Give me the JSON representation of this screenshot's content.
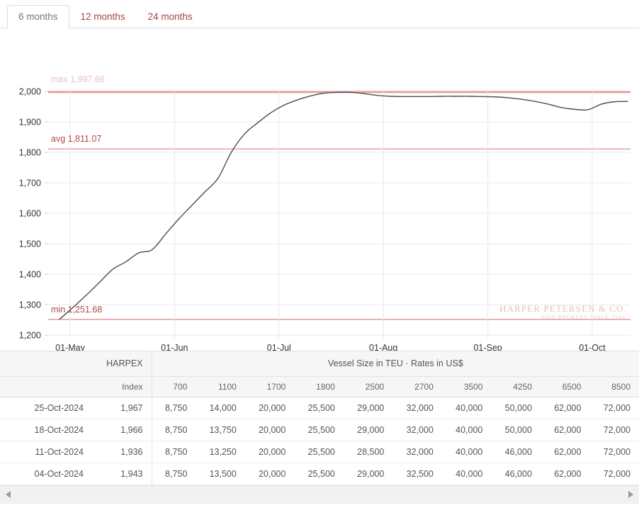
{
  "tabs": [
    {
      "label": "6 months",
      "active": true
    },
    {
      "label": "12 months",
      "active": false
    },
    {
      "label": "24 months",
      "active": false
    }
  ],
  "colors": {
    "accent": "#a94442",
    "reference_line": "#e8a0a0",
    "series_line": "#4d4d4d",
    "grid": "#e8e8e8",
    "watermark": "#e2bfc0"
  },
  "chart_data": {
    "type": "line",
    "title": "",
    "xlabel": "",
    "ylabel": "",
    "ylim": [
      1200,
      2000
    ],
    "grid": true,
    "legend": "none",
    "ytick_labels": [
      "2,000",
      "1,900",
      "1,800",
      "1,700",
      "1,600",
      "1,500",
      "1,400",
      "1,300",
      "1,200"
    ],
    "yticks": [
      2000,
      1900,
      1800,
      1700,
      1600,
      1500,
      1400,
      1300,
      1200
    ],
    "xtick_labels": [
      "01-May",
      "01-Jun",
      "01-Jul",
      "01-Aug",
      "01-Sep",
      "01-Oct"
    ],
    "reference_lines": [
      {
        "name": "max",
        "label": "max 1,997.66",
        "value": 1998,
        "clipped": true
      },
      {
        "name": "avg",
        "label": "avg 1,811.07",
        "value": 1811.07,
        "clipped": false
      },
      {
        "name": "min",
        "label": "min 1,251.68",
        "value": 1251.68,
        "clipped": false
      }
    ],
    "series": [
      {
        "name": "HARPEX",
        "values": [
          1252,
          1290,
          1330,
          1372,
          1415,
          1440,
          1470,
          1480,
          1530,
          1580,
          1625,
          1670,
          1715,
          1800,
          1860,
          1897,
          1930,
          1955,
          1972,
          1985,
          1994,
          1997,
          1997,
          1993,
          1987,
          1984,
          1983,
          1983,
          1983,
          1984,
          1984,
          1984,
          1983,
          1982,
          1979,
          1974,
          1967,
          1958,
          1947,
          1941,
          1940,
          1958,
          1966,
          1967
        ]
      }
    ],
    "annotations": [
      {
        "text": "HARPER PETERSEN & CO.",
        "type": "watermark"
      },
      {
        "text": "SHIP BROKERS SINCE 1943",
        "type": "watermark-sub"
      }
    ]
  },
  "table": {
    "group_header_left": "HARPEX",
    "group_header_right": "Vessel Size in TEU · Rates in US$",
    "date_header": "",
    "index_header": "Index",
    "size_headers": [
      "700",
      "1100",
      "1700",
      "1800",
      "2500",
      "2700",
      "3500",
      "4250",
      "6500",
      "8500"
    ],
    "rows": [
      {
        "date": "25-Oct-2024",
        "index": "1,967",
        "rates": [
          "8,750",
          "14,000",
          "20,000",
          "25,500",
          "29,000",
          "32,000",
          "40,000",
          "50,000",
          "62,000",
          "72,000"
        ]
      },
      {
        "date": "18-Oct-2024",
        "index": "1,966",
        "rates": [
          "8,750",
          "13,750",
          "20,000",
          "25,500",
          "29,000",
          "32,000",
          "40,000",
          "50,000",
          "62,000",
          "72,000"
        ]
      },
      {
        "date": "11-Oct-2024",
        "index": "1,936",
        "rates": [
          "8,750",
          "13,250",
          "20,000",
          "25,500",
          "28,500",
          "32,000",
          "40,000",
          "46,000",
          "62,000",
          "72,000"
        ]
      },
      {
        "date": "04-Oct-2024",
        "index": "1,943",
        "rates": [
          "8,750",
          "13,500",
          "20,000",
          "25,500",
          "29,000",
          "32,500",
          "40,000",
          "46,000",
          "62,000",
          "72,000"
        ]
      }
    ]
  },
  "scrollbar": {
    "left_arrow": "◀",
    "right_arrow": "▶"
  }
}
